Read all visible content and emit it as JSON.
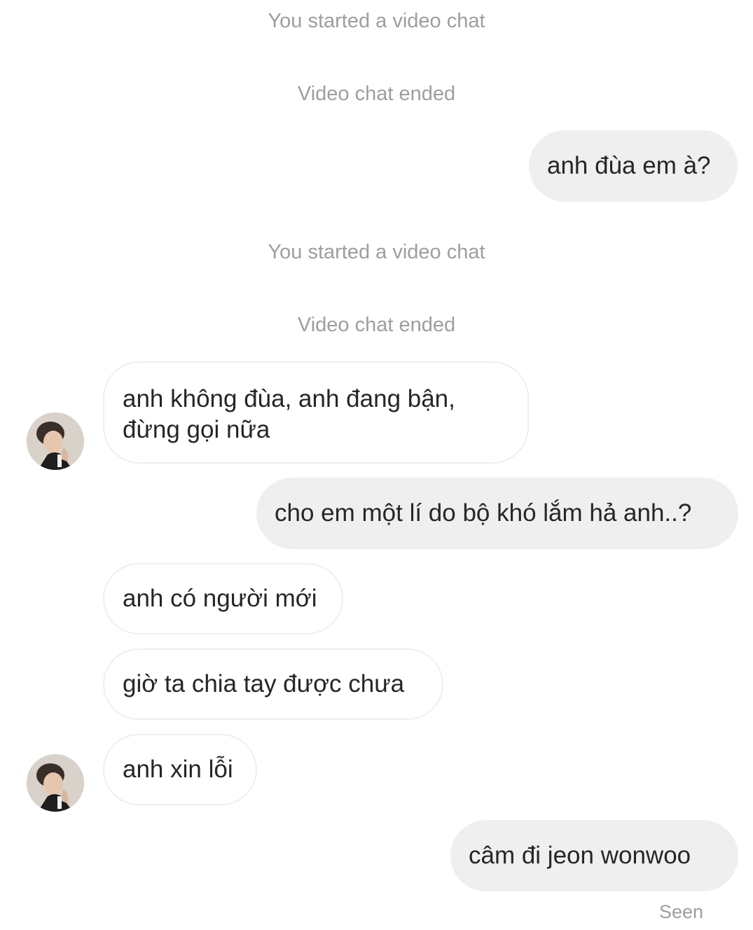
{
  "system_messages": [
    {
      "text": "You started a video chat"
    },
    {
      "text": "Video chat ended"
    },
    {
      "text": "You started a video chat"
    },
    {
      "text": "Video chat ended"
    }
  ],
  "messages": [
    {
      "direction": "out",
      "text": "anh đùa em à?"
    },
    {
      "direction": "in",
      "text": "anh không đùa, anh đang bận,\nđừng gọi nữa"
    },
    {
      "direction": "out",
      "text": "cho em một lí do bộ khó lắm hả anh..?"
    },
    {
      "direction": "in",
      "text": "anh có người mới"
    },
    {
      "direction": "in",
      "text": "giờ ta chia tay được chưa"
    },
    {
      "direction": "in",
      "text": "anh xin lỗi"
    },
    {
      "direction": "out",
      "text": "câm đi jeon wonwoo"
    }
  ],
  "status": {
    "seen": "Seen"
  },
  "colors": {
    "outgoing_bubble": "#efefef",
    "incoming_border": "#efefef",
    "system_text": "#9e9e9e",
    "message_text": "#262626"
  }
}
